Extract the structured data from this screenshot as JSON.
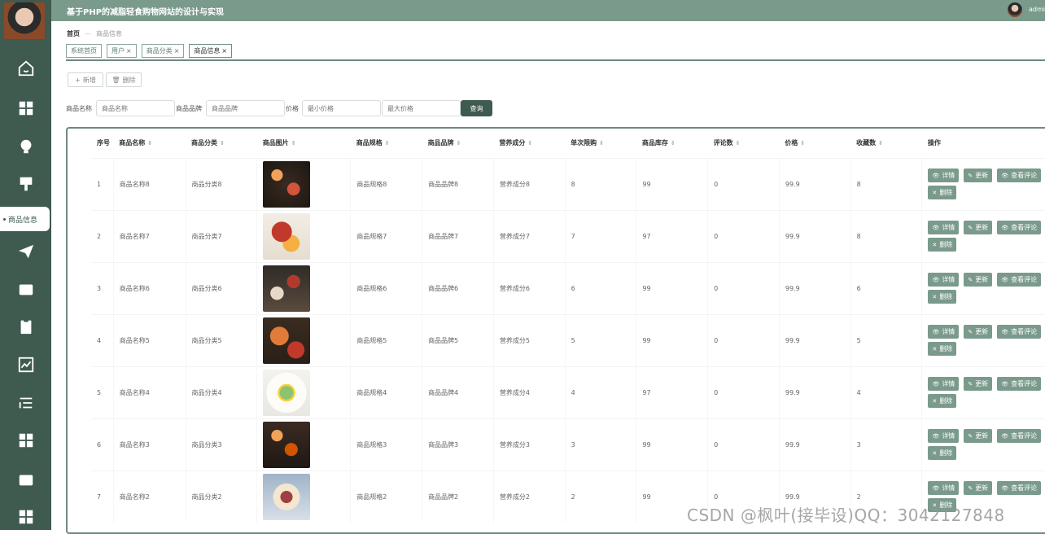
{
  "header": {
    "title": "基于PHP的减脂轻食购物网站的设计与实现",
    "user": "admi"
  },
  "sidebar": {
    "active_label": "商品信息"
  },
  "breadcrumb": {
    "home": "首页",
    "current": "商品信息"
  },
  "tabs": [
    {
      "label": "系统首页",
      "close": ""
    },
    {
      "label": "用户",
      "close": "×"
    },
    {
      "label": "商品分类",
      "close": "×"
    },
    {
      "label": "商品信息",
      "close": "×"
    }
  ],
  "actions": {
    "add": "新增",
    "delete": "删除"
  },
  "search": {
    "name_label": "商品名称",
    "name_placeholder": "商品名称",
    "brand_label": "商品品牌",
    "brand_placeholder": "商品品牌",
    "price_label": "价格",
    "min_placeholder": "最小价格",
    "max_placeholder": "最大价格",
    "button": "查询"
  },
  "table": {
    "columns": [
      "序号",
      "商品名称",
      "商品分类",
      "商品图片",
      "商品规格",
      "商品品牌",
      "营养成分",
      "单次限购",
      "商品库存",
      "评论数",
      "价格",
      "收藏数",
      "操作"
    ],
    "sortable": [
      "",
      "⇕",
      "⇕",
      "⇕",
      "⇕",
      "⇕",
      "⇕",
      "⇕",
      "⇕",
      "⇕",
      "⇕",
      "⇕",
      ""
    ],
    "op_labels": {
      "detail": "详情",
      "update": "更新",
      "comments": "查看评论",
      "delete": "删除"
    },
    "rows": [
      {
        "no": "1",
        "name": "商品名称8",
        "category": "商品分类8",
        "spec": "商品规格8",
        "brand": "商品品牌8",
        "nutrition": "营养成分8",
        "limit": "8",
        "stock": "99",
        "comments": "0",
        "price": "99.9",
        "favorites": "8"
      },
      {
        "no": "2",
        "name": "商品名称7",
        "category": "商品分类7",
        "spec": "商品规格7",
        "brand": "商品品牌7",
        "nutrition": "营养成分7",
        "limit": "7",
        "stock": "97",
        "comments": "0",
        "price": "99.9",
        "favorites": "8"
      },
      {
        "no": "3",
        "name": "商品名称6",
        "category": "商品分类6",
        "spec": "商品规格6",
        "brand": "商品品牌6",
        "nutrition": "营养成分6",
        "limit": "6",
        "stock": "99",
        "comments": "0",
        "price": "99.9",
        "favorites": "6"
      },
      {
        "no": "4",
        "name": "商品名称5",
        "category": "商品分类5",
        "spec": "商品规格5",
        "brand": "商品品牌5",
        "nutrition": "营养成分5",
        "limit": "5",
        "stock": "99",
        "comments": "0",
        "price": "99.9",
        "favorites": "5"
      },
      {
        "no": "5",
        "name": "商品名称4",
        "category": "商品分类4",
        "spec": "商品规格4",
        "brand": "商品品牌4",
        "nutrition": "营养成分4",
        "limit": "4",
        "stock": "97",
        "comments": "0",
        "price": "99.9",
        "favorites": "4"
      },
      {
        "no": "6",
        "name": "商品名称3",
        "category": "商品分类3",
        "spec": "商品规格3",
        "brand": "商品品牌3",
        "nutrition": "营养成分3",
        "limit": "3",
        "stock": "99",
        "comments": "0",
        "price": "99.9",
        "favorites": "3"
      },
      {
        "no": "7",
        "name": "商品名称2",
        "category": "商品分类2",
        "spec": "商品规格2",
        "brand": "商品品牌2",
        "nutrition": "营养成分2",
        "limit": "2",
        "stock": "99",
        "comments": "0",
        "price": "99.9",
        "favorites": "2"
      }
    ]
  },
  "watermark": "CSDN @枫叶(接毕设)QQ：3042127848",
  "colors": {
    "sidebar": "#3f5a4f",
    "header": "#7a9a8c",
    "button": "#7a9a8c",
    "accent": "#3f5a4f"
  }
}
